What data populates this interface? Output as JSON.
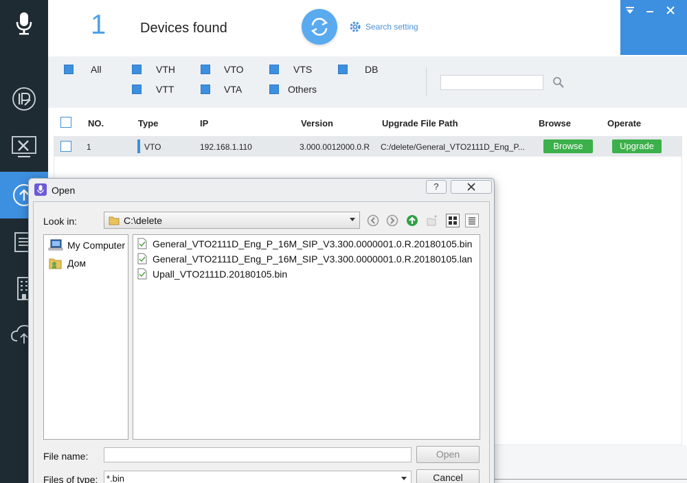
{
  "sidebar": {
    "items": [
      {
        "icon": "microphone-icon"
      },
      {
        "icon": "ip-icon"
      },
      {
        "icon": "config-tools-icon"
      },
      {
        "icon": "upgrade-icon",
        "active": true
      },
      {
        "icon": "document-icon"
      },
      {
        "icon": "building-icon"
      },
      {
        "icon": "cloud-upload-icon"
      }
    ]
  },
  "header": {
    "device_count": "1",
    "devices_found_label": "Devices found",
    "search_setting_label": "Search setting"
  },
  "filters": {
    "row1": [
      "All",
      "VTH",
      "VTO",
      "VTS",
      "DB"
    ],
    "row2": [
      "VTT",
      "VTA",
      "Others"
    ],
    "search_value": ""
  },
  "table": {
    "columns": [
      "NO.",
      "Type",
      "IP",
      "Version",
      "Upgrade File Path",
      "Browse",
      "Operate"
    ],
    "rows": [
      {
        "no": "1",
        "type": "VTO",
        "ip": "192.168.1.110",
        "version": "3.000.0012000.0.R",
        "path": "C:/delete/General_VTO2111D_Eng_P...",
        "browse_label": "Browse",
        "operate_label": "Upgrade"
      }
    ]
  },
  "dialog": {
    "title": "Open",
    "help_glyph": "?",
    "look_in_label": "Look in:",
    "look_in_value": "C:\\delete",
    "places": [
      "My Computer",
      "Дом"
    ],
    "files": [
      "General_VTO2111D_Eng_P_16M_SIP_V3.300.0000001.0.R.20180105.bin",
      "General_VTO2111D_Eng_P_16M_SIP_V3.300.0000001.0.R.20180105.lan",
      "Upall_VTO2111D.20180105.bin"
    ],
    "file_name_label": "File name:",
    "file_name_value": "",
    "files_of_type_label": "Files of type:",
    "files_of_type_value": "*.bin",
    "open_button": "Open",
    "cancel_button": "Cancel"
  },
  "colors": {
    "sidebar_bg": "#1f2b33",
    "accent_blue": "#3d8fe0",
    "button_green": "#3cb04a",
    "filter_bg": "#eef1f4"
  }
}
